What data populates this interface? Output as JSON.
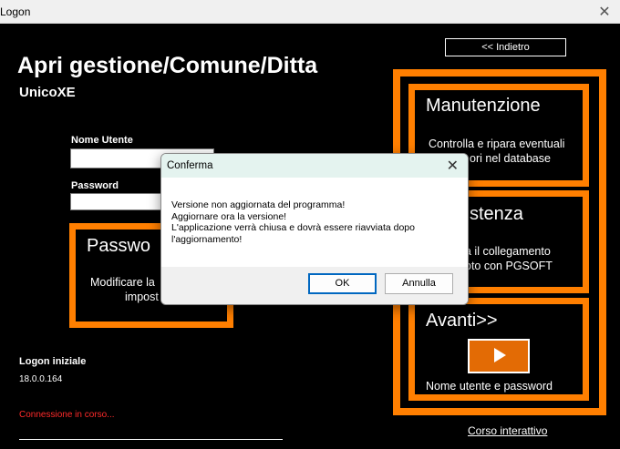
{
  "window": {
    "title": "Logon",
    "close_glyph": "✕"
  },
  "back_button": {
    "label": "<< Indietro"
  },
  "header": {
    "title": "Apri gestione/Comune/Ditta",
    "subtitle": "UnicoXE"
  },
  "login": {
    "username_label": "Nome Utente",
    "password_label": "Password",
    "password_panel": {
      "title": "Passwo",
      "line1": "Modificare la",
      "line2": "impost"
    }
  },
  "footer_info": {
    "logon_label": "Logon iniziale",
    "version": "18.0.0.164",
    "status": "Connessione in corso..."
  },
  "right_panels": {
    "manutenzione": {
      "title": "Manutenzione",
      "line1": "Controlla e ripara eventuali",
      "line2": "ori nel database"
    },
    "assistenza": {
      "title": "stenza",
      "line1": "a il collegamento",
      "line2": "oto con PGSOFT"
    },
    "avanti": {
      "title": "Avanti>>",
      "caption": "Nome utente e password"
    }
  },
  "corso_link": "Corso interattivo",
  "dialog": {
    "title": "Conferma",
    "close_glyph": "✕",
    "lines": [
      "Versione non aggiornata del programma!",
      "Aggiornare ora la versione!",
      "L'applicazione verrà chiusa e dovrà essere riavviata dopo",
      "l'aggiornamento!"
    ],
    "ok": "OK",
    "cancel": "Annulla"
  },
  "colors": {
    "accent": "#ff7f00",
    "background": "#000000",
    "status_red": "#ff2a2a"
  },
  "icons": {
    "play": "play-icon"
  }
}
